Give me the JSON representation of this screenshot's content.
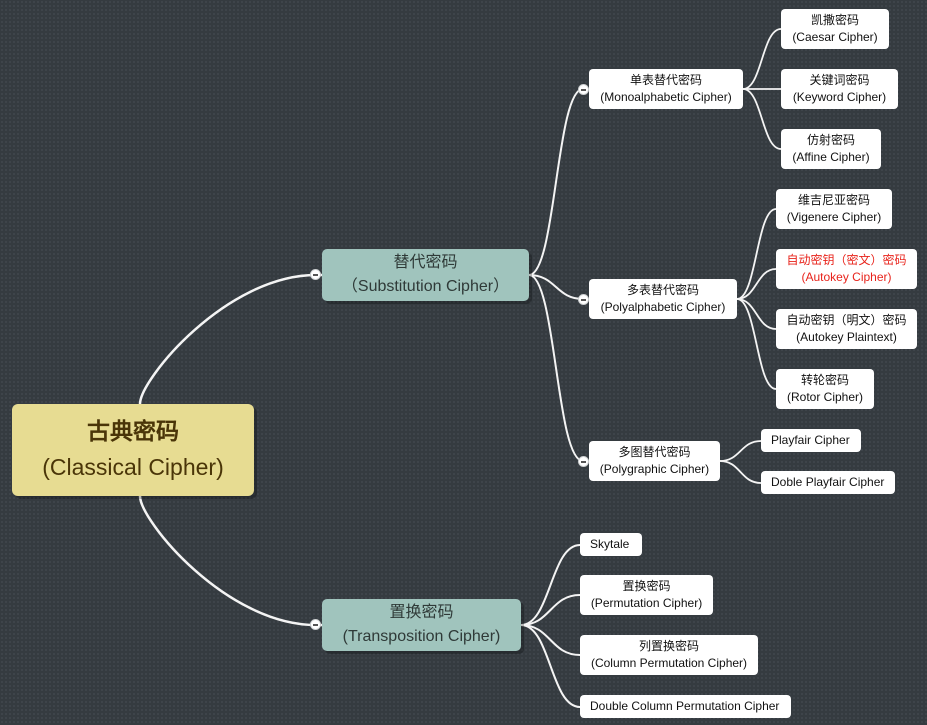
{
  "mindmap": {
    "root": {
      "zh": "古典密码",
      "en": "(Classical Cipher)",
      "color": "#e7dc92"
    },
    "branches": [
      {
        "zh": "替代密码",
        "en": "（Substitution Cipher）",
        "children": [
          {
            "zh": "单表替代密码",
            "en": "(Monoalphabetic Cipher)",
            "children": [
              {
                "zh": "凯撒密码",
                "en": "(Caesar Cipher)"
              },
              {
                "zh": "关键词密码",
                "en": "(Keyword Cipher)"
              },
              {
                "zh": "仿射密码",
                "en": "(Affine Cipher)"
              }
            ]
          },
          {
            "zh": "多表替代密码",
            "en": "(Polyalphabetic Cipher)",
            "children": [
              {
                "zh": "维吉尼亚密码",
                "en": "(Vigenere Cipher)"
              },
              {
                "zh": "自动密钥（密文）密码",
                "en": "(Autokey Cipher)",
                "highlight": "#e8231b"
              },
              {
                "zh": "自动密钥（明文）密码",
                "en": "(Autokey Plaintext)"
              },
              {
                "zh": "转轮密码",
                "en": "(Rotor Cipher)"
              }
            ]
          },
          {
            "zh": "多图替代密码",
            "en": "(Polygraphic Cipher)",
            "children": [
              {
                "label": "Playfair Cipher"
              },
              {
                "label": "Doble Playfair Cipher"
              }
            ]
          }
        ]
      },
      {
        "zh": "置换密码",
        "en": "(Transposition Cipher)",
        "children": [
          {
            "label": "Skytale"
          },
          {
            "zh": "置换密码",
            "en": "(Permutation Cipher)"
          },
          {
            "zh": "列置换密码",
            "en": "(Column Permutation Cipher)"
          },
          {
            "label": "Double Column Permutation Cipher"
          }
        ]
      }
    ]
  }
}
